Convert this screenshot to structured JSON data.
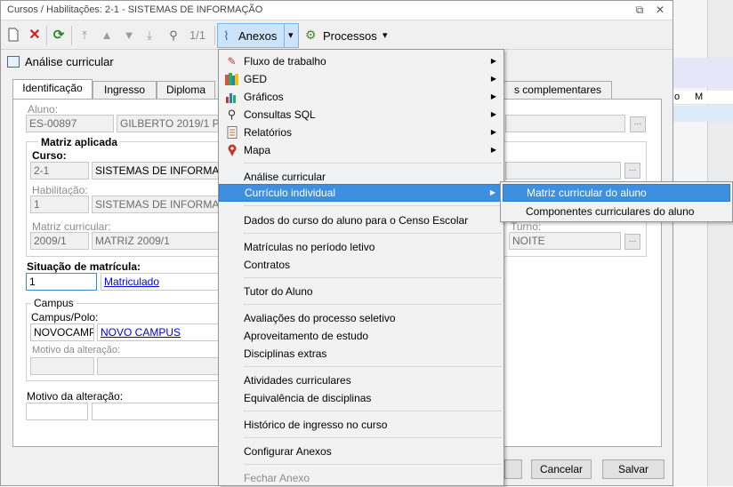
{
  "window": {
    "title": "Cursos / Habilitações: 2-1 - SISTEMAS DE INFORMAÇÃO",
    "restore_glyph": "⧉",
    "close_glyph": "✕"
  },
  "toolbar": {
    "record_counter": "1/1",
    "anexos_label": "Anexos",
    "processos_label": "Processos",
    "dropdown_glyph": "▾"
  },
  "panel": {
    "title": "Análise curricular"
  },
  "tabs": [
    {
      "label": "Identificação"
    },
    {
      "label": "Ingresso"
    },
    {
      "label": "Diploma"
    },
    {
      "label": "s complementares"
    }
  ],
  "form": {
    "aluno_label": "Aluno:",
    "aluno_code": "ES-00897",
    "aluno_name": "GILBERTO 2019/1 PO",
    "matriz_group": "Matriz aplicada",
    "curso_label": "Curso:",
    "curso_code": "2-1",
    "curso_name": "SISTEMAS DE INFORMAÇÃ",
    "habilitacao_label": "Habilitação:",
    "habilitacao_code": "1",
    "habilitacao_name": "SISTEMAS DE INFORMAÇÃ",
    "matriz_label": "Matriz curricular:",
    "matriz_code": "2009/1",
    "matriz_name": "MATRIZ 2009/1",
    "turno_label": "Turno:",
    "turno_value": "NOITE",
    "situacao_label": "Situação de matrícula:",
    "situacao_code": "1",
    "situacao_name": "Matriculado",
    "campus_group": "Campus",
    "campus_label": "Campus/Polo:",
    "campus_code": "NOVOCAMPU",
    "campus_name": "NOVO CAMPUS",
    "motivo_inner_label": "Motivo da alteração:",
    "motivo_label": "Motivo da alteração:",
    "ellipsis": "..."
  },
  "grid": {
    "col1": "o",
    "col2": "M"
  },
  "buttons": {
    "cancel": "Cancelar",
    "save": "Salvar"
  },
  "menu": {
    "items": [
      {
        "label": "Fluxo de trabalho",
        "icon": "workflow-icon"
      },
      {
        "label": "GED",
        "icon": "ged-icon"
      },
      {
        "label": "Gráficos",
        "icon": "chart-icon"
      },
      {
        "label": "Consultas SQL",
        "icon": "sql-query-icon"
      },
      {
        "label": "Relatórios",
        "icon": "report-icon"
      },
      {
        "label": "Mapa",
        "icon": "map-pin-icon"
      },
      {
        "label": "Análise curricular"
      },
      {
        "label": "Currículo individual"
      },
      {
        "label": "Dados do curso do aluno para o Censo Escolar"
      },
      {
        "label": "Matrículas no período letivo"
      },
      {
        "label": "Contratos"
      },
      {
        "label": "Tutor do Aluno"
      },
      {
        "label": "Avaliações do processo seletivo"
      },
      {
        "label": "Aproveitamento de estudo"
      },
      {
        "label": "Disciplinas extras"
      },
      {
        "label": "Atividades curriculares"
      },
      {
        "label": "Equivalência de disciplinas"
      },
      {
        "label": "Histórico de ingresso no curso"
      },
      {
        "label": "Configurar Anexos"
      },
      {
        "label": "Fechar Anexo"
      }
    ],
    "submenu_glyph": "▶"
  },
  "submenu": {
    "items": [
      {
        "label": "Matriz curricular do aluno"
      },
      {
        "label": "Componentes curriculares do aluno"
      }
    ]
  },
  "colors": {
    "highlight": "#3f8fe0",
    "hover_button": "#cce4f7"
  }
}
